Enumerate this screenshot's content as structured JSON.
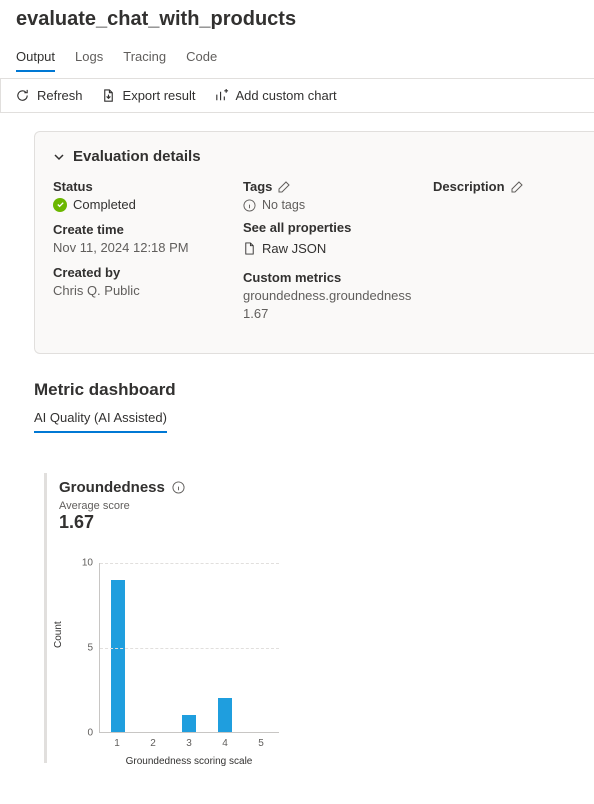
{
  "title": "evaluate_chat_with_products",
  "tabs": [
    "Output",
    "Logs",
    "Tracing",
    "Code"
  ],
  "toolbar": {
    "refresh": "Refresh",
    "export": "Export result",
    "add_chart": "Add custom chart"
  },
  "details": {
    "heading": "Evaluation details",
    "status_label": "Status",
    "status_value": "Completed",
    "create_time_label": "Create time",
    "create_time_value": "Nov 11, 2024 12:18 PM",
    "created_by_label": "Created by",
    "created_by_value": "Chris Q. Public",
    "tags_label": "Tags",
    "no_tags": "No tags",
    "see_all": "See all properties",
    "raw_json": "Raw JSON",
    "custom_metrics_label": "Custom metrics",
    "custom_metric_name": "groundedness.groundedness",
    "custom_metric_value": "1.67",
    "description_label": "Description"
  },
  "dashboard": {
    "heading": "Metric dashboard",
    "subtab": "AI Quality (AI Assisted)"
  },
  "chart": {
    "title": "Groundedness",
    "avg_label": "Average score",
    "avg_value": "1.67"
  },
  "chart_data": {
    "type": "bar",
    "title": "Groundedness",
    "xlabel": "Groundedness scoring scale",
    "ylabel": "Count",
    "ylim": [
      0,
      10
    ],
    "yticks": [
      0,
      5,
      10
    ],
    "categories": [
      "1",
      "2",
      "3",
      "4",
      "5"
    ],
    "values": [
      9,
      0,
      1,
      2,
      0
    ]
  }
}
